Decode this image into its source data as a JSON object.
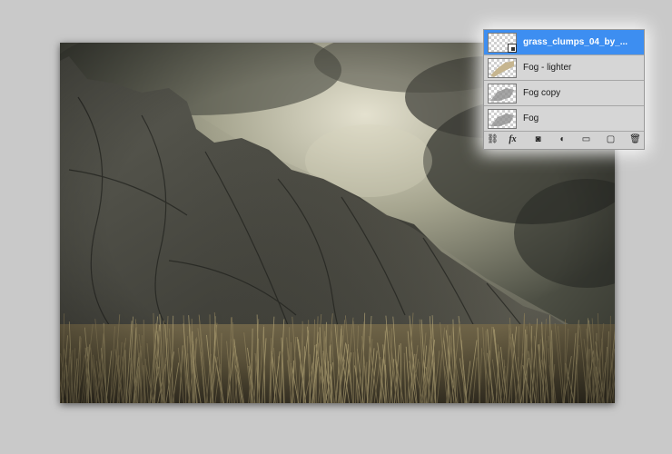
{
  "layers_panel": {
    "layers": [
      {
        "name": "grass_clumps_04_by_...",
        "selected": true,
        "thumb": "smart-object-thumbnail"
      },
      {
        "name": "Fog - lighter",
        "selected": false,
        "thumb": "fog-lighter-thumbnail"
      },
      {
        "name": "Fog copy",
        "selected": false,
        "thumb": "fog-thumbnail"
      },
      {
        "name": "Fog",
        "selected": false,
        "thumb": "fog-thumbnail"
      }
    ],
    "footer_icons": [
      {
        "name": "link-layers-icon",
        "glyph": "⛓"
      },
      {
        "name": "layer-style-fx-icon",
        "glyph": "fx"
      },
      {
        "name": "add-mask-icon",
        "glyph": "◙"
      },
      {
        "name": "adjustment-layer-icon",
        "glyph": "◐"
      },
      {
        "name": "new-group-folder-icon",
        "glyph": "▭"
      },
      {
        "name": "new-layer-icon",
        "glyph": "▢"
      },
      {
        "name": "trash-icon",
        "glyph": "🗑"
      }
    ]
  },
  "colors": {
    "selection_blue": "#3d8ef1",
    "panel_bg": "#d6d6d6",
    "workspace_bg": "#c9c9c9"
  }
}
